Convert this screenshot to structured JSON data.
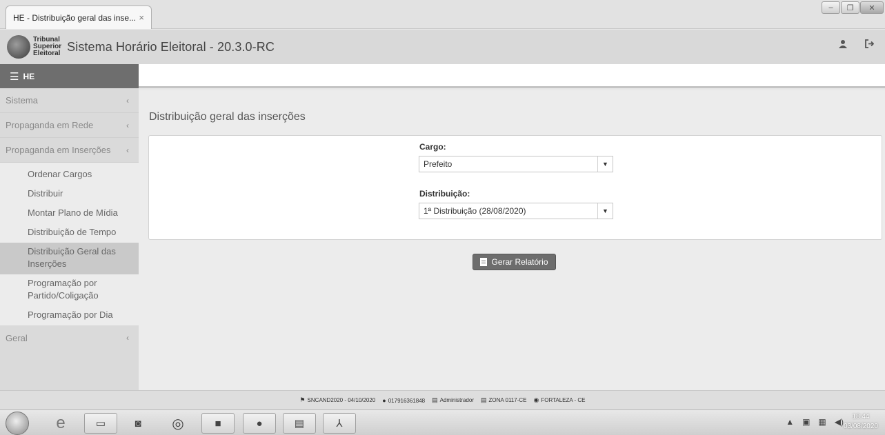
{
  "browser": {
    "tab_title": "HE - Distribuição geral das inse...",
    "tab_close": "×",
    "win_minimize": "–",
    "win_restore": "❐",
    "win_close": "✕"
  },
  "header": {
    "logo_line1": "Tribunal",
    "logo_line2": "Superior",
    "logo_line3": "Eleitoral",
    "title": "Sistema Horário Eleitoral - 20.3.0-RC",
    "user_icon": "user-icon",
    "logout_icon": "logout-icon"
  },
  "sidebar": {
    "toggle_label": "HE",
    "groups": [
      {
        "label": "Sistema"
      },
      {
        "label": "Propaganda em Rede"
      },
      {
        "label": "Propaganda em Inserções"
      }
    ],
    "sub_items": [
      {
        "label": "Ordenar Cargos"
      },
      {
        "label": "Distribuir"
      },
      {
        "label": "Montar Plano de Mídia"
      },
      {
        "label": "Distribuição de Tempo"
      },
      {
        "label": "Distribuição Geral das Inserções"
      },
      {
        "label": "Programação por Partido/Coligação"
      },
      {
        "label": "Programação por Dia"
      }
    ],
    "last_group": {
      "label": "Geral"
    },
    "chevron": "‹"
  },
  "main": {
    "page_title": "Distribuição geral das inserções",
    "cargo_label": "Cargo:",
    "cargo_value": "Prefeito",
    "distribuicao_label": "Distribuição:",
    "distribuicao_value": "1ª Distribuição (28/08/2020)",
    "generate_button": "Gerar Relatório"
  },
  "footer": {
    "system": "SNCAND2020 - 04/10/2020",
    "user_id": "017916361848",
    "role": "Administrador",
    "zone": "ZONA 0117-CE",
    "location": "FORTALEZA  -  CE"
  },
  "taskbar": {
    "time": "18:44",
    "date": "03/08/2020"
  }
}
